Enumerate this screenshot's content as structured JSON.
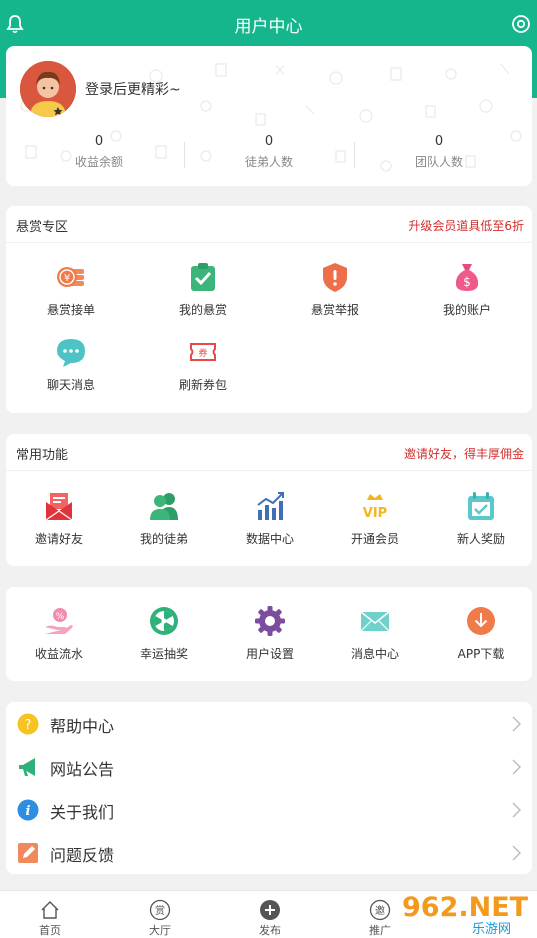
{
  "header": {
    "title": "用户中心",
    "left_icon": "bell-icon",
    "right_icon": "settings-icon"
  },
  "user": {
    "login_prompt": "登录后更精彩~",
    "stats": [
      {
        "value": "0",
        "label": "收益余额"
      },
      {
        "value": "0",
        "label": "徒弟人数"
      },
      {
        "value": "0",
        "label": "团队人数"
      }
    ]
  },
  "bounty": {
    "title": "悬赏专区",
    "promo": "升级会员道具低至6折",
    "items": [
      {
        "label": "悬赏接单",
        "icon": "coins-icon"
      },
      {
        "label": "我的悬赏",
        "icon": "clipboard-check-icon"
      },
      {
        "label": "悬赏举报",
        "icon": "shield-alert-icon"
      },
      {
        "label": "我的账户",
        "icon": "money-bag-icon"
      },
      {
        "label": "聊天消息",
        "icon": "chat-bubble-icon"
      },
      {
        "label": "刷新券包",
        "icon": "coupon-icon"
      }
    ]
  },
  "common": {
    "title": "常用功能",
    "promo": "邀请好友，得丰厚佣金",
    "items": [
      {
        "label": "邀请好友",
        "icon": "invite-envelope-icon"
      },
      {
        "label": "我的徒弟",
        "icon": "users-icon"
      },
      {
        "label": "数据中心",
        "icon": "bar-chart-icon"
      },
      {
        "label": "开通会员",
        "icon": "vip-crown-icon"
      },
      {
        "label": "新人奖励",
        "icon": "calendar-check-icon"
      }
    ]
  },
  "more": {
    "items": [
      {
        "label": "收益流水",
        "icon": "hand-coin-icon"
      },
      {
        "label": "幸运抽奖",
        "icon": "lucky-wheel-icon"
      },
      {
        "label": "用户设置",
        "icon": "gear-icon"
      },
      {
        "label": "消息中心",
        "icon": "mail-icon"
      },
      {
        "label": "APP下载",
        "icon": "download-icon"
      }
    ]
  },
  "list": [
    {
      "label": "帮助中心",
      "icon": "question-icon"
    },
    {
      "label": "网站公告",
      "icon": "megaphone-icon"
    },
    {
      "label": "关于我们",
      "icon": "info-icon"
    },
    {
      "label": "问题反馈",
      "icon": "edit-icon"
    }
  ],
  "tabs": [
    {
      "label": "首页",
      "icon": "home-icon"
    },
    {
      "label": "大厅",
      "icon": "hall-icon",
      "glyph": "赏"
    },
    {
      "label": "发布",
      "icon": "plus-circle-icon"
    },
    {
      "label": "推广",
      "icon": "invite-icon",
      "glyph": "邀"
    }
  ],
  "watermark": {
    "text": "962.NET",
    "subtext": "乐游网"
  },
  "colors": {
    "brand": "#16b68c",
    "promo": "#d0302e"
  }
}
